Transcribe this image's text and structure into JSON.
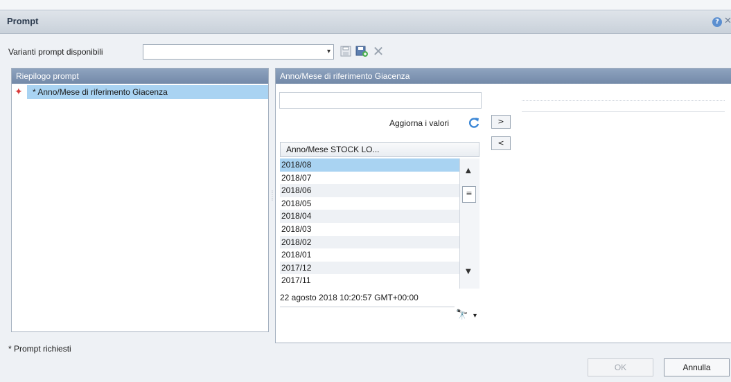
{
  "dialog": {
    "title": "Prompt",
    "help_glyph": "?",
    "close_glyph": "✕"
  },
  "variants": {
    "label": "Varianti prompt disponibili",
    "selected_value": "",
    "dropdown_glyph": "▾",
    "delete_glyph": "✕"
  },
  "summary": {
    "header": "Riepilogo prompt",
    "items": [
      {
        "label": "* Anno/Mese di riferimento Giacenza",
        "indicator_glyph": "✦"
      }
    ]
  },
  "detail": {
    "header": "Anno/Mese di riferimento Giacenza",
    "search_value": "",
    "refresh_label": "Aggiorna i valori",
    "move_right": ">",
    "move_left": "<",
    "column_header": "Anno/Mese STOCK LO...",
    "values": [
      "2018/08",
      "2018/07",
      "2018/06",
      "2018/05",
      "2018/04",
      "2018/03",
      "2018/02",
      "2018/01",
      "2017/12",
      "2017/11"
    ],
    "selected_value": "2018/08",
    "timestamp": "22 agosto 2018 10:20:57 GMT+00:00",
    "find_value": "",
    "scroll_up": "▲",
    "scroll_thumb": "≡",
    "scroll_down": "▼",
    "find_dropdown": "▾",
    "find_glyph": "🔭"
  },
  "footer": {
    "required_note": "* Prompt richiesti",
    "ok_label": "OK",
    "cancel_label": "Annulla"
  },
  "colors": {
    "header_blue": "#7f95b4",
    "selection_blue": "#a9d3f2",
    "indicator_red": "#d83a3a"
  }
}
